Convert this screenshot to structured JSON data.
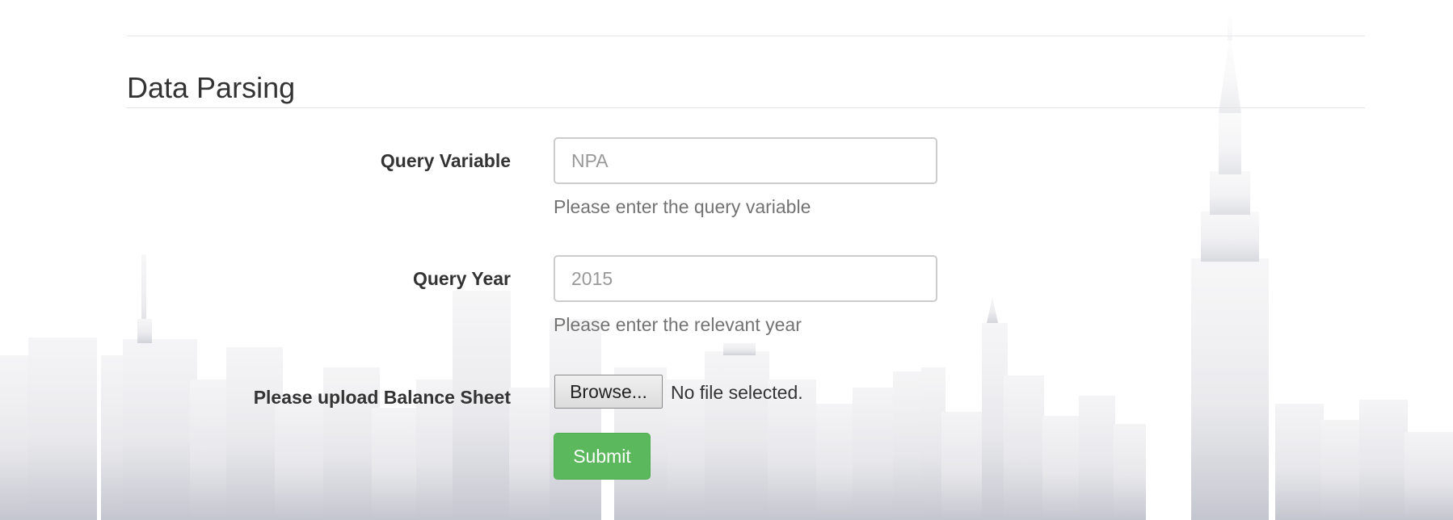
{
  "form": {
    "legend": "Data Parsing",
    "query_variable": {
      "label": "Query Variable",
      "placeholder": "NPA",
      "value": "",
      "help": "Please enter the query variable"
    },
    "query_year": {
      "label": "Query Year",
      "placeholder": "2015",
      "value": "",
      "help": "Please enter the relevant year"
    },
    "upload": {
      "label": "Please upload Balance Sheet",
      "browse_label": "Browse...",
      "status": "No file selected."
    },
    "submit_label": "Submit"
  },
  "colors": {
    "submit_bg": "#5cb85c",
    "skyline": "#dcdde3"
  }
}
